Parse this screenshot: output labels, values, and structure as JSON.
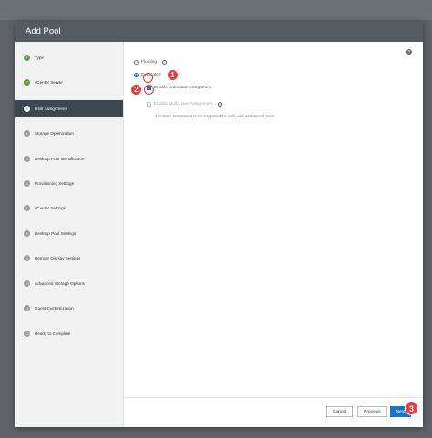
{
  "dialog": {
    "title": "Add Pool"
  },
  "steps": [
    {
      "marker": "✓",
      "kind": "check",
      "label": "Type"
    },
    {
      "marker": "✓",
      "kind": "check",
      "label": "vCenter Server"
    },
    {
      "marker": "3",
      "kind": "num",
      "label": "User Assignment",
      "active": true
    },
    {
      "marker": "4",
      "kind": "num",
      "label": "Storage Optimization"
    },
    {
      "marker": "5",
      "kind": "num",
      "label": "Desktop Pool Identification"
    },
    {
      "marker": "6",
      "kind": "num",
      "label": "Provisioning Settings"
    },
    {
      "marker": "7",
      "kind": "num",
      "label": "vCenter Settings"
    },
    {
      "marker": "8",
      "kind": "num",
      "label": "Desktop Pool Settings"
    },
    {
      "marker": "9",
      "kind": "num",
      "label": "Remote Display Settings"
    },
    {
      "marker": "10",
      "kind": "num",
      "label": "Advanced Storage Options"
    },
    {
      "marker": "11",
      "kind": "num",
      "label": "Guest Customization"
    },
    {
      "marker": "12",
      "kind": "num",
      "label": "Ready to Complete"
    }
  ],
  "user_assignment": {
    "floating_label": "Floating",
    "dedicated_label": "Dedicated",
    "enable_auto_label": "Enable Automatic Assignment",
    "enable_multi_label": "Enable Multi-User Assignment",
    "multi_note": "Automatic assignment is not supported for multi-user assignment pools."
  },
  "help_icon": "?",
  "info_icon": "i",
  "callouts": [
    "1",
    "2",
    "3"
  ],
  "footer": {
    "cancel_label": "Cancel",
    "previous_label": "Previous",
    "next_label": "Next"
  },
  "colors": {
    "accent": "#1a73c8",
    "sidebar_active": "#3d4750",
    "step_done": "#5f9e4a",
    "callout": "#e53d3d"
  }
}
